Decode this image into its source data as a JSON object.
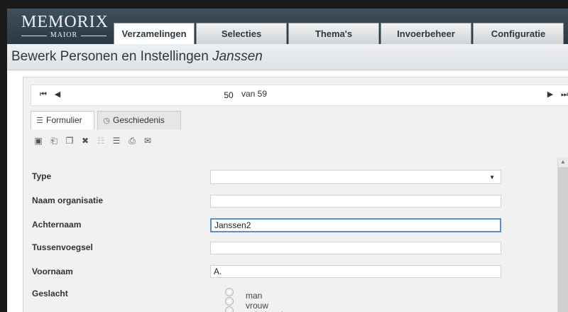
{
  "app": {
    "logo_line1": "MEMORIX",
    "logo_line2": "MAIOR"
  },
  "tabs": [
    {
      "label": "Verzamelingen",
      "active": true
    },
    {
      "label": "Selecties"
    },
    {
      "label": "Thema's"
    },
    {
      "label": "Invoerbeheer"
    },
    {
      "label": "Configuratie"
    }
  ],
  "page": {
    "title_prefix": "Bewerk Personen en Instellingen",
    "title_name": "Janssen"
  },
  "pager": {
    "current": "50",
    "of_text": "van 59"
  },
  "subtabs": [
    {
      "label": "Formulier",
      "icon": "form-icon"
    },
    {
      "label": "Geschiedenis",
      "icon": "history-icon"
    }
  ],
  "toolbar_icons": [
    "save-icon",
    "export-icon",
    "copy-icon",
    "delete-icon",
    "disabled-doc-icon",
    "document-icon",
    "print-icon",
    "mail-icon"
  ],
  "form": {
    "type_label": "Type",
    "type_value": "",
    "org_label": "Naam organisatie",
    "org_value": "",
    "lastname_label": "Achternaam",
    "lastname_value": "Janssen2",
    "infix_label": "Tussenvoegsel",
    "infix_value": "",
    "firstname_label": "Voornaam",
    "firstname_value": "A.",
    "gender_label": "Geslacht",
    "gender_options": [
      "man",
      "vrouw",
      "onbekend"
    ]
  },
  "colors": {
    "topbar": "#2b3944",
    "focus_border": "#5b8fc7"
  }
}
